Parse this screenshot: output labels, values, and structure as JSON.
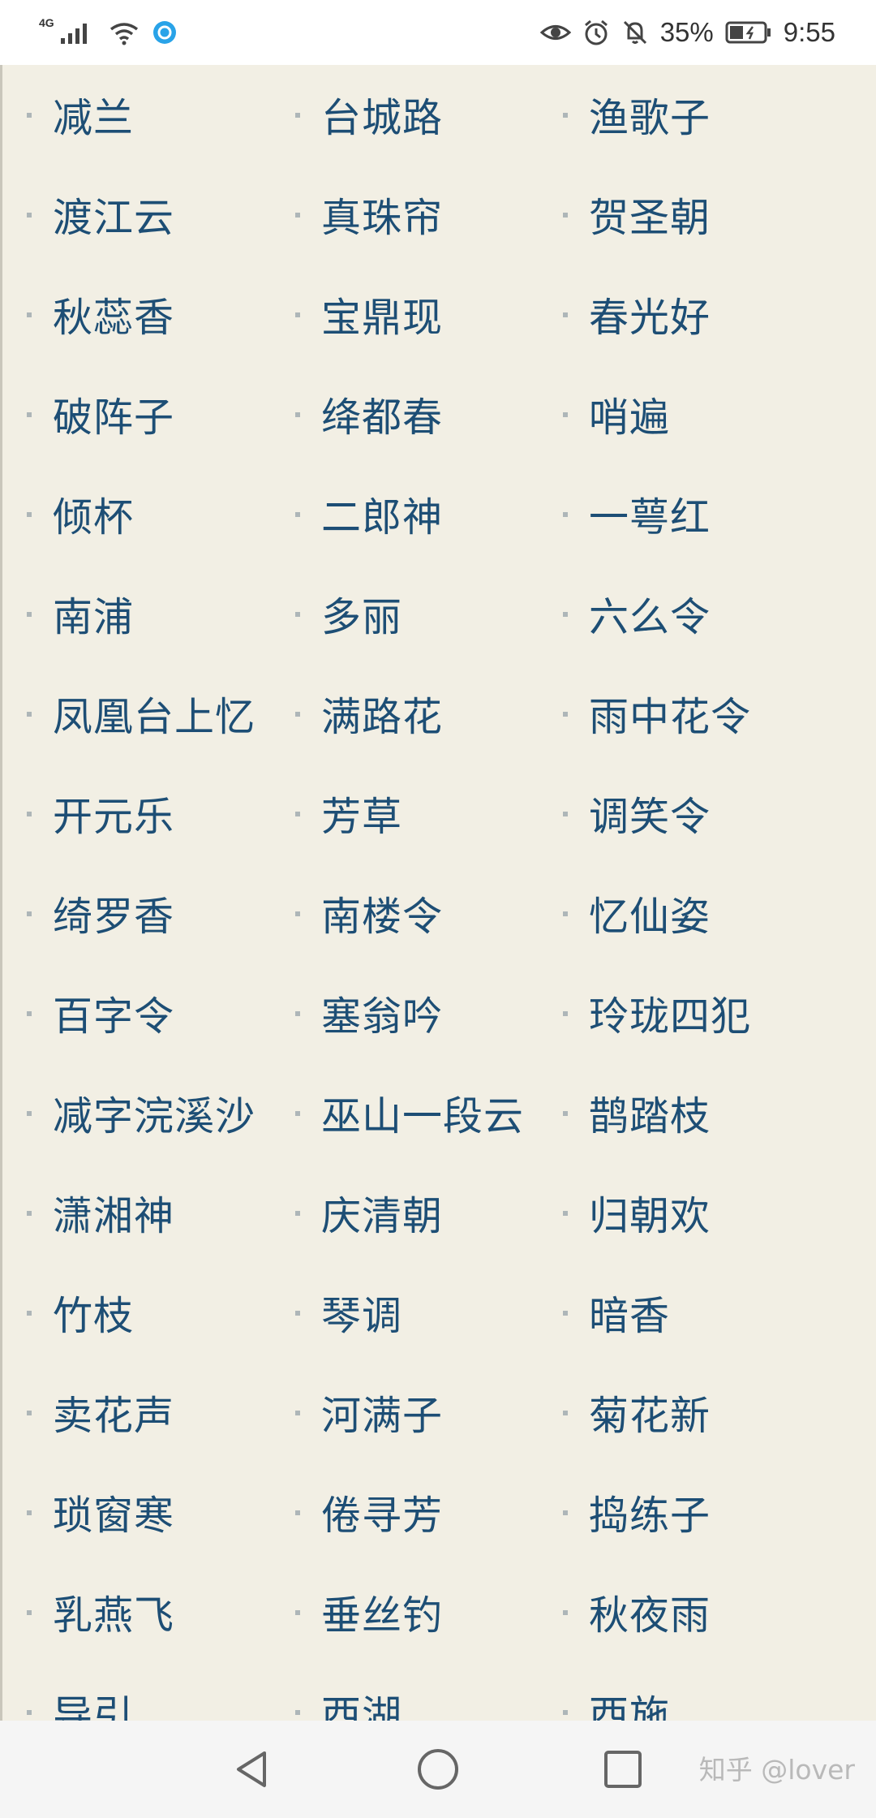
{
  "status_bar": {
    "network": "4G",
    "battery": "35%",
    "time": "9:55",
    "icons": [
      "signal-icon",
      "wifi-icon",
      "app-notification-icon",
      "eye-icon",
      "alarm-icon",
      "mute-icon",
      "battery-icon"
    ]
  },
  "list": [
    [
      "减兰",
      "台城路",
      "渔歌子"
    ],
    [
      "渡江云",
      "真珠帘",
      "贺圣朝"
    ],
    [
      "秋蕊香",
      "宝鼎现",
      "春光好"
    ],
    [
      "破阵子",
      "绛都春",
      "哨遍"
    ],
    [
      "倾杯",
      "二郎神",
      "一萼红"
    ],
    [
      "南浦",
      "多丽",
      "六么令"
    ],
    [
      "凤凰台上忆",
      "满路花",
      "雨中花令"
    ],
    [
      "开元乐",
      "芳草",
      "调笑令"
    ],
    [
      "绮罗香",
      "南楼令",
      "忆仙姿"
    ],
    [
      "百字令",
      "塞翁吟",
      "玲珑四犯"
    ],
    [
      "减字浣溪沙",
      "巫山一段云",
      "鹊踏枝"
    ],
    [
      "潇湘神",
      "庆清朝",
      "归朝欢"
    ],
    [
      "竹枝",
      "琴调",
      "暗香"
    ],
    [
      "卖花声",
      "河满子",
      "菊花新"
    ],
    [
      "琐窗寒",
      "倦寻芳",
      "捣练子"
    ],
    [
      "乳燕飞",
      "垂丝钓",
      "秋夜雨"
    ],
    [
      "导引",
      "西湖",
      "西施"
    ]
  ],
  "nav_bar": {
    "icons": [
      "back-icon",
      "home-icon",
      "recents-icon"
    ],
    "watermark": "知乎 @lover"
  },
  "colors": {
    "page_background": "#f2efe4",
    "link_text": "#1d4e75",
    "bullet": "#aeb6b8"
  }
}
